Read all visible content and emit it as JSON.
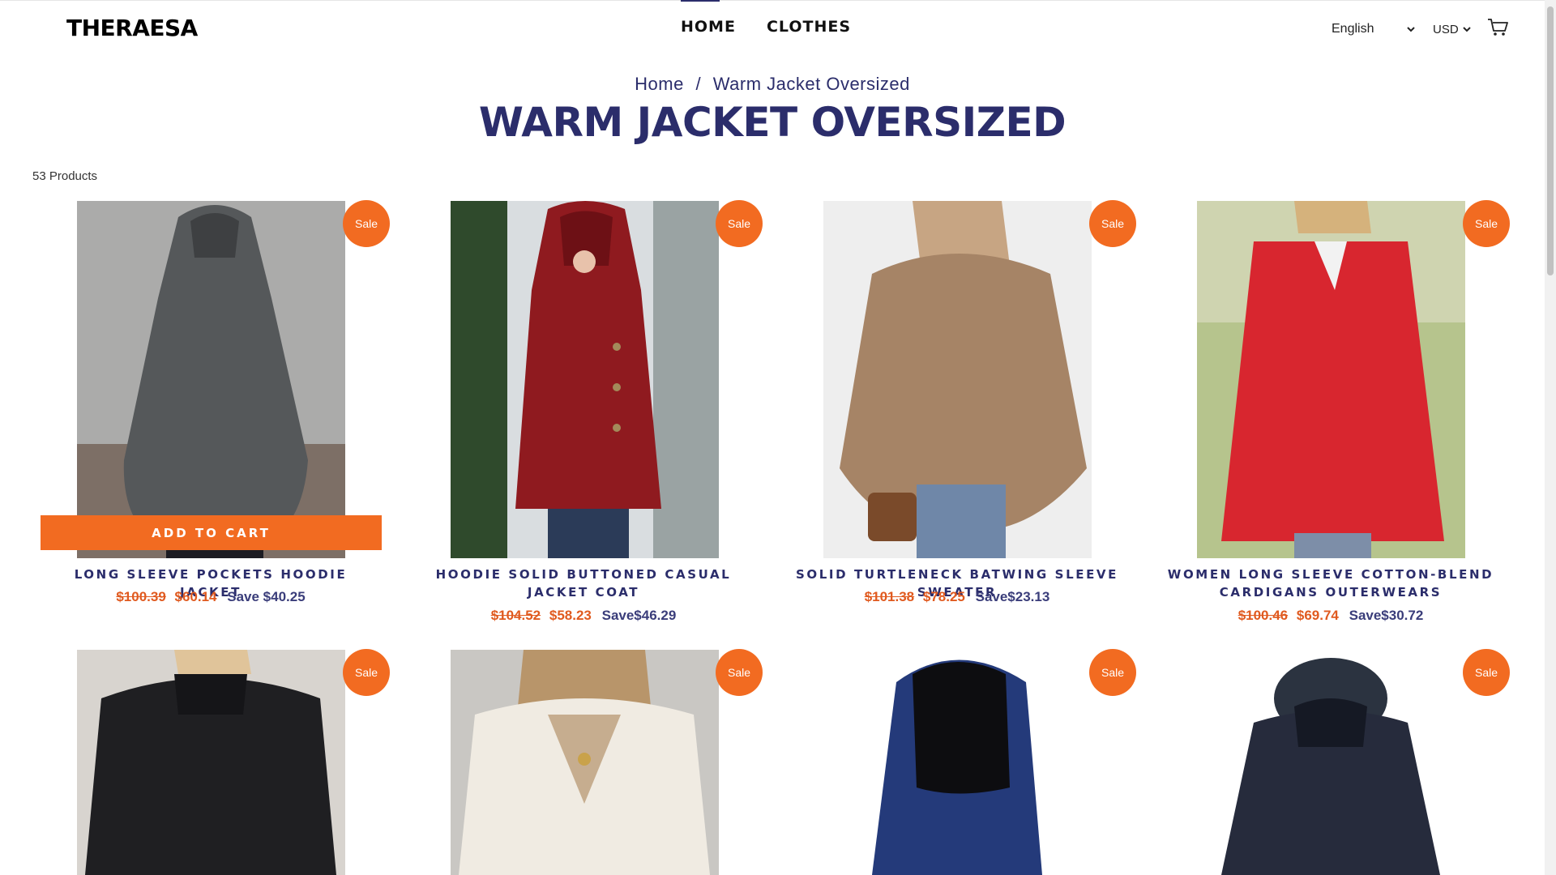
{
  "header": {
    "logo": "THERAESA",
    "nav": [
      "HOME",
      "CLOTHES"
    ],
    "language": "English",
    "currency": "USD"
  },
  "breadcrumb": {
    "home": "Home",
    "separator": "/",
    "current": "Warm Jacket Oversized"
  },
  "title": "WARM JACKET OVERSIZED",
  "product_count": "53 Products",
  "add_to_cart": "ADD TO CART",
  "badge": "Sale",
  "colors": {
    "accent": "#f26b21",
    "navy": "#2b2d6b"
  },
  "products": [
    {
      "name": "LONG SLEEVE POCKETS HOODIE JACKET",
      "old_price": "$100.39",
      "price": "$60.14",
      "save": "Save $40.25"
    },
    {
      "name": "HOODIE SOLID BUTTONED CASUAL JACKET COAT",
      "old_price": "$104.52",
      "price": "$58.23",
      "save": "Save$46.29"
    },
    {
      "name": "SOLID TURTLENECK BATWING SLEEVE SWEATER",
      "old_price": "$101.38",
      "price": "$78.25",
      "save": "Save$23.13"
    },
    {
      "name": "WOMEN LONG SLEEVE COTTON-BLEND CARDIGANS OUTERWEARS",
      "old_price": "$100.46",
      "price": "$69.74",
      "save": "Save$30.72"
    }
  ]
}
